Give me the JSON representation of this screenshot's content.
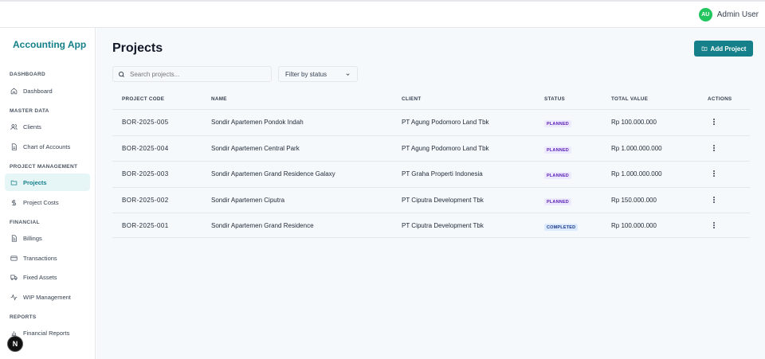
{
  "header": {
    "user": {
      "initials": "AU",
      "name": "Admin User"
    }
  },
  "sidebar": {
    "brand": "Accounting App",
    "sections": [
      {
        "title": "DASHBOARD",
        "items": [
          {
            "label": "Dashboard",
            "icon": "home-icon"
          }
        ]
      },
      {
        "title": "MASTER DATA",
        "items": [
          {
            "label": "Clients",
            "icon": "users-icon"
          },
          {
            "label": "Chart of Accounts",
            "icon": "document-icon"
          }
        ]
      },
      {
        "title": "PROJECT MANAGEMENT",
        "items": [
          {
            "label": "Projects",
            "icon": "folder-icon",
            "active": true
          },
          {
            "label": "Project Costs",
            "icon": "dollar-icon"
          }
        ]
      },
      {
        "title": "FINANCIAL",
        "items": [
          {
            "label": "Billings",
            "icon": "file-text-icon"
          },
          {
            "label": "Transactions",
            "icon": "credit-card-icon"
          },
          {
            "label": "Fixed Assets",
            "icon": "truck-icon"
          },
          {
            "label": "WIP Management",
            "icon": "activity-icon"
          }
        ]
      },
      {
        "title": "REPORTS",
        "items": [
          {
            "label": "Financial Reports",
            "icon": "bar-chart-icon"
          }
        ]
      }
    ]
  },
  "dev_badge": "N",
  "main": {
    "title": "Projects",
    "add_button": "Add Project",
    "search_placeholder": "Search projects...",
    "filter_label": "Filter by status",
    "columns": [
      "PROJECT CODE",
      "NAME",
      "CLIENT",
      "STATUS",
      "TOTAL VALUE",
      "ACTIONS"
    ],
    "rows": [
      {
        "code": "BOR-2025-005",
        "name": "Sondir Apartemen Pondok Indah",
        "client": "PT Agung Podomoro Land Tbk",
        "status": "PLANNED",
        "value": "Rp 100.000.000"
      },
      {
        "code": "BOR-2025-004",
        "name": "Sondir Apartemen Central Park",
        "client": "PT Agung Podomoro Land Tbk",
        "status": "PLANNED",
        "value": "Rp 1.000.000.000"
      },
      {
        "code": "BOR-2025-003",
        "name": "Sondir Apartemen Grand Residence Galaxy",
        "client": "PT Graha Properti Indonesia",
        "status": "PLANNED",
        "value": "Rp 1.000.000.000"
      },
      {
        "code": "BOR-2025-002",
        "name": "Sondir Apartemen Ciputra",
        "client": "PT Ciputra Development Tbk",
        "status": "PLANNED",
        "value": "Rp 150.000.000"
      },
      {
        "code": "BOR-2025-001",
        "name": "Sondir Apartemen Grand Residence",
        "client": "PT Ciputra Development Tbk",
        "status": "COMPLETED",
        "value": "Rp 100.000.000"
      }
    ]
  },
  "colors": {
    "accent": "#15808a",
    "avatar": "#22c55e",
    "planned_bg": "#ede9fe",
    "completed_bg": "#dbeafe"
  }
}
